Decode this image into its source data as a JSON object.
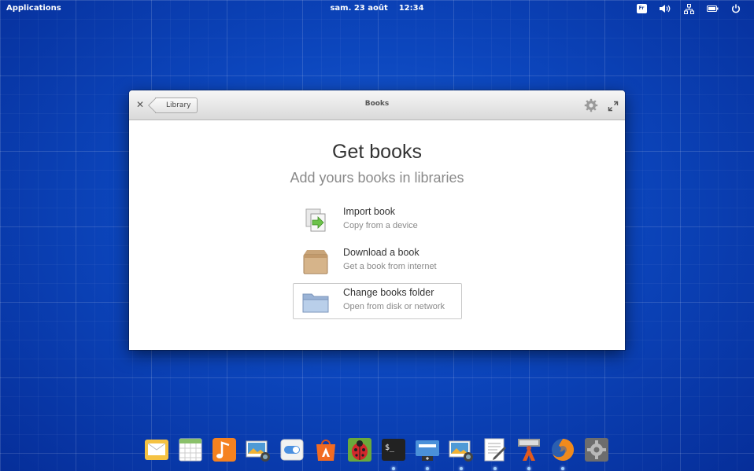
{
  "panel": {
    "applications_label": "Applications",
    "clock": "sam. 23 août    12:34",
    "keyboard_layout": "Fr",
    "indicators": [
      "keyboard-layout-icon",
      "volume-icon",
      "network-icon",
      "battery-icon",
      "power-icon"
    ]
  },
  "window": {
    "title": "Books",
    "back_label": "Library",
    "heading": "Get books",
    "subheading": "Add yours books in libraries",
    "actions": [
      {
        "title": "Import book",
        "subtitle": "Copy from a device",
        "icon": "import-document-icon"
      },
      {
        "title": "Download a book",
        "subtitle": "Get a book from internet",
        "icon": "package-box-icon"
      },
      {
        "title": "Change books folder",
        "subtitle": "Open from disk or network",
        "icon": "folder-icon",
        "selected": true
      }
    ]
  },
  "dock": {
    "items": [
      {
        "name": "mail-icon",
        "running": false
      },
      {
        "name": "calendar-icon",
        "running": false
      },
      {
        "name": "music-icon",
        "running": false
      },
      {
        "name": "photos-icon",
        "running": false
      },
      {
        "name": "switchboard-toggle-icon",
        "running": false
      },
      {
        "name": "app-center-icon",
        "running": false
      },
      {
        "name": "ladybug-icon",
        "running": false
      },
      {
        "name": "terminal-icon",
        "running": true
      },
      {
        "name": "screenshot-icon",
        "running": true
      },
      {
        "name": "photos-icon",
        "running": true
      },
      {
        "name": "text-editor-icon",
        "running": true
      },
      {
        "name": "books-app-icon",
        "running": true
      },
      {
        "name": "firefox-icon",
        "running": true
      },
      {
        "name": "system-settings-icon",
        "running": false
      }
    ]
  },
  "colors": {
    "desktop_blue": "#0a3fb0",
    "titlebar_top": "#f6f6f6",
    "titlebar_bottom": "#d9d9d9"
  }
}
